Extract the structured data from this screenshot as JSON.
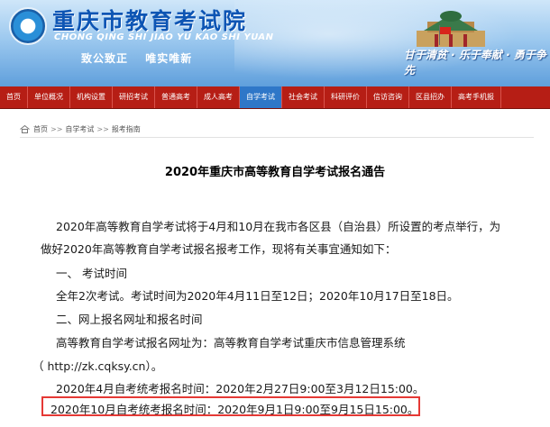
{
  "header": {
    "site_title": "重庆市教育考试院",
    "site_pinyin": "CHONG QING SHI JIAO YU KAO SHI YUAN",
    "motto": [
      "致公致正",
      "唯实唯新"
    ],
    "slogan": "甘于清贫 · 乐于奉献 · 勇于争先"
  },
  "nav": {
    "items": [
      "首页",
      "单位概况",
      "机构设置",
      "研招考试",
      "普通高考",
      "成人高考",
      "自学考试",
      "社会考试",
      "科研评价",
      "信访咨询",
      "区县招办",
      "高考手机报"
    ],
    "active_index": 6
  },
  "breadcrumb": {
    "home": "首页",
    "sep": ">>",
    "items": [
      "自学考试",
      "报考指南"
    ]
  },
  "article": {
    "title": "2020年重庆市高等教育自学考试报名通告",
    "lines": [
      "2020年高等教育自学考试将于4月和10月在我市各区县（自治县）所设置的考点举行，为",
      "做好2020年高等教育自学考试报名报考工作，现将有关事宜通知如下：",
      "一、    考试时间",
      "全年2次考试。考试时间为2020年4月11日至12日；2020年10月17日至18日。",
      "二、网上报名网址和报名时间",
      "高等教育自学考试报名网址为：高等教育自学考试重庆市信息管理系统",
      "（ http://zk.cqksy.cn）。",
      "2020年4月自考统考报名时间：2020年2月27日9:00至3月12日15:00。",
      "2020年10月自考统考报名时间：2020年9月1日9:00至9月15日15:00。"
    ]
  },
  "colors": {
    "nav_bg": "#b61e15",
    "nav_active": "#2f77c8",
    "title_blue": "#0d55b4",
    "highlight": "#e53935"
  }
}
